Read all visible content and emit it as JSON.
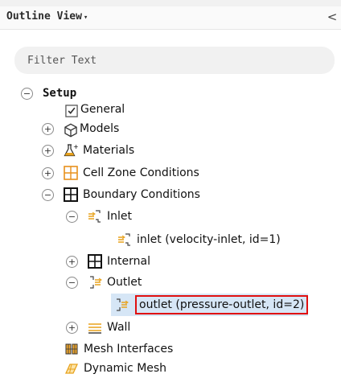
{
  "header": {
    "title": "Outline View",
    "caret": "▾",
    "collapse": "<"
  },
  "filter": {
    "placeholder": "Filter Text"
  },
  "tree": {
    "setup": "Setup",
    "general": "General",
    "models": "Models",
    "materials": "Materials",
    "cell_zone": "Cell Zone Conditions",
    "boundary": "Boundary Conditions",
    "inlet_group": "Inlet",
    "inlet_item": "inlet (velocity-inlet, id=1)",
    "internal": "Internal",
    "outlet_group": "Outlet",
    "outlet_item": "outlet (pressure-outlet, id=2)",
    "wall": "Wall",
    "mesh_interfaces": "Mesh Interfaces",
    "dynamic_mesh": "Dynamic Mesh"
  },
  "icons": {
    "expand": "+",
    "collapse": "−"
  },
  "colors": {
    "selection_bg": "#d6e6f6",
    "highlight_border": "#e01010"
  }
}
